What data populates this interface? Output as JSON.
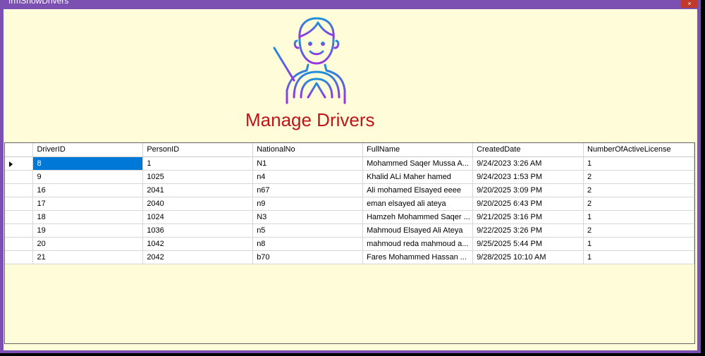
{
  "window": {
    "title": "frmShowDrivers",
    "close_label": "×"
  },
  "heading": "Manage Drivers",
  "table": {
    "columns": [
      "DriverID",
      "PersonID",
      "NationalNo",
      "FullName",
      "CreatedDate",
      "NumberOfActiveLicense"
    ],
    "rows": [
      [
        "8",
        "1",
        "N1",
        "Mohammed Saqer Mussa A...",
        "9/24/2023 3:26 AM",
        "1"
      ],
      [
        "9",
        "1025",
        "n4",
        "Khalid ALi Maher hamed",
        "9/24/2023 1:53 PM",
        "2"
      ],
      [
        "16",
        "2041",
        "n67",
        "Ali mohamed Elsayed eeee",
        "9/20/2025 3:09 PM",
        "2"
      ],
      [
        "17",
        "2040",
        "n9",
        "eman elsayed ali ateya",
        "9/20/2025 6:43 PM",
        "2"
      ],
      [
        "18",
        "1024",
        "N3",
        "Hamzeh Mohammed Saqer ...",
        "9/21/2025 3:16 PM",
        "1"
      ],
      [
        "19",
        "1036",
        "n5",
        "Mahmoud Elsayed Ali Ateya",
        "9/22/2025 3:26 PM",
        "2"
      ],
      [
        "20",
        "1042",
        "n8",
        "mahmoud reda mahmoud a...",
        "9/25/2025 5:44 PM",
        "1"
      ],
      [
        "21",
        "2042",
        "b70",
        "Fares Mohammed Hassan ...",
        "9/28/2025 10:10 AM",
        "1"
      ]
    ],
    "selected_row": 0
  },
  "icons": {
    "logo": "driver-steering-wheel-icon",
    "row_indicator": "current-row-arrow-icon"
  },
  "colors": {
    "titlebar": "#7c4fb3",
    "background": "#fffdd9",
    "heading": "#c0141b",
    "selection": "#0078d7"
  }
}
